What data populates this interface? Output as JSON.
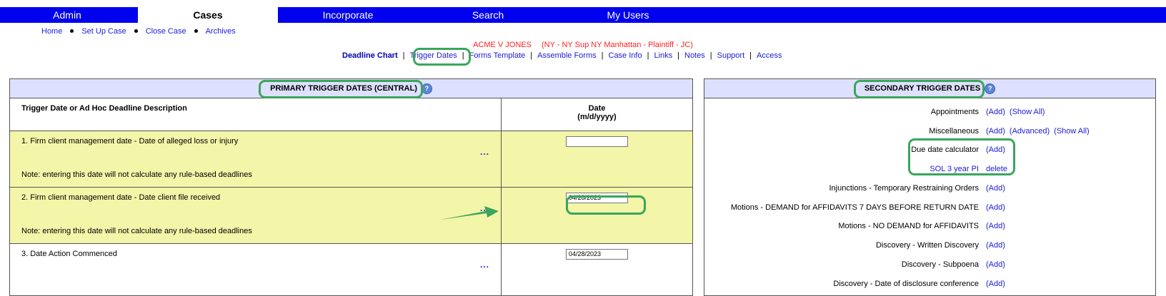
{
  "topnav": {
    "tabs": [
      {
        "label": "Admin"
      },
      {
        "label": "Cases"
      },
      {
        "label": "Incorporate"
      },
      {
        "label": "Search"
      },
      {
        "label": "My Users"
      }
    ]
  },
  "subnav": {
    "items": [
      {
        "label": "Home"
      },
      {
        "label": "Set Up Case"
      },
      {
        "label": "Close Case"
      },
      {
        "label": "Archives"
      }
    ]
  },
  "case": {
    "name": "ACME V JONES",
    "details": "(NY - NY Sup NY Manhattan - Plaintiff - JC)"
  },
  "chartnav": {
    "current": "Deadline Chart",
    "links": [
      {
        "label": "Trigger Dates"
      },
      {
        "label": "Forms Template"
      },
      {
        "label": "Assemble Forms"
      },
      {
        "label": "Case Info"
      },
      {
        "label": "Links"
      },
      {
        "label": "Notes"
      },
      {
        "label": "Support"
      },
      {
        "label": "Access"
      }
    ]
  },
  "primary": {
    "title": "PRIMARY TRIGGER DATES (CENTRAL)",
    "col1_header": "Trigger Date or Ad Hoc Deadline Description",
    "col2_header_line1": "Date",
    "col2_header_line2": "(m/d/yyyy)",
    "more_label": "...",
    "rows": [
      {
        "desc": "1. Firm client management date - Date of alleged loss or injury",
        "note": "Note: entering this date will not calculate any rule-based deadlines",
        "date": ""
      },
      {
        "desc": "2. Firm client management date - Date client file received",
        "note": "Note: entering this date will not calculate any rule-based deadlines",
        "date": "04/28/2023"
      },
      {
        "desc": "3. Date Action Commenced",
        "note": "",
        "date": "04/28/2023"
      }
    ]
  },
  "secondary": {
    "title": "SECONDARY TRIGGER DATES",
    "rows": [
      {
        "label": "Appointments",
        "actions": [
          "(Add)",
          "(Show All)"
        ]
      },
      {
        "label": "Miscellaneous",
        "actions": [
          "(Add)",
          "(Advanced)",
          "(Show All)"
        ]
      },
      {
        "label": "Due date calculator",
        "actions": [
          "(Add)"
        ]
      },
      {
        "label": "SOL 3 year PI",
        "actions": [
          "delete"
        ]
      },
      {
        "label": "Injunctions - Temporary Restraining Orders",
        "actions": [
          "(Add)"
        ]
      },
      {
        "label": "Motions - DEMAND for AFFIDAVITS 7 DAYS BEFORE RETURN DATE",
        "actions": [
          "(Add)"
        ]
      },
      {
        "label": "Motions - NO DEMAND for AFFIDAVITS",
        "actions": [
          "(Add)"
        ]
      },
      {
        "label": "Discovery - Written Discovery",
        "actions": [
          "(Add)"
        ]
      },
      {
        "label": "Discovery - Subpoena",
        "actions": [
          "(Add)"
        ]
      },
      {
        "label": "Discovery - Date of disclosure conference",
        "actions": [
          "(Add)"
        ]
      }
    ]
  },
  "colors": {
    "nav_blue": "#0000ee",
    "panel_head": "#dde1ff",
    "row_yellow": "#f3f5a8",
    "highlight_green": "#3aa55c",
    "case_red": "#ff2222",
    "link_blue": "#1a1adb"
  },
  "icons": {
    "help": "question-mark-circle",
    "arrow": "green-arrow-pointer"
  }
}
